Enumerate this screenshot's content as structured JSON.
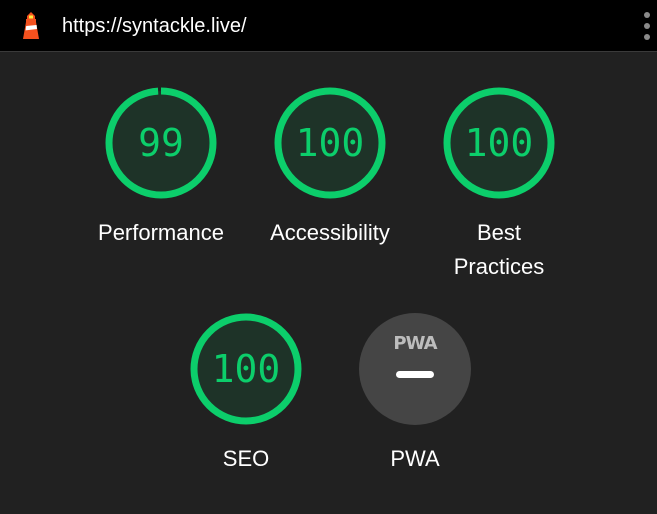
{
  "toolbar": {
    "url": "https://syntackle.live/",
    "logo_icon": "lighthouse-icon",
    "menu_icon": "more-vertical-icon"
  },
  "scores": [
    {
      "label": "Performance",
      "value": "99",
      "fraction": 0.99
    },
    {
      "label": "Accessibility",
      "value": "100",
      "fraction": 1.0
    },
    {
      "label_lines": [
        "Best",
        "Practices"
      ],
      "value": "100",
      "fraction": 1.0
    },
    {
      "label": "SEO",
      "value": "100",
      "fraction": 1.0
    }
  ],
  "pwa": {
    "badge": "PWA",
    "label": "PWA",
    "icon": "pwa-badge-icon",
    "status_icon": "dash-icon"
  },
  "colors": {
    "pass": "#0cce6b",
    "gauge_fill": "#1e3328",
    "background": "#212121",
    "toolbar": "#000000",
    "neutral": "#454545"
  }
}
